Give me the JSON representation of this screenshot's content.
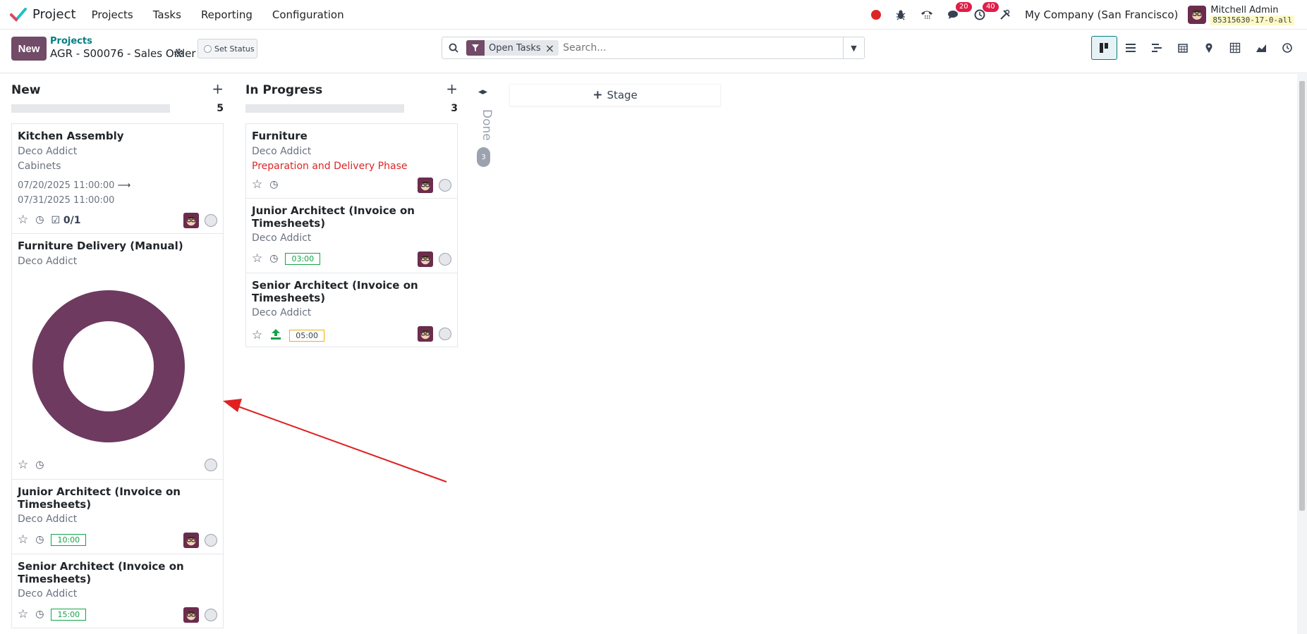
{
  "navbar": {
    "app_name": "Project",
    "menu": [
      "Projects",
      "Tasks",
      "Reporting",
      "Configuration"
    ],
    "messages_badge": "20",
    "activities_badge": "40",
    "company": "My Company (San Francisco)",
    "user_name": "Mitchell Admin",
    "db_name": "85315630-17-0-all"
  },
  "control": {
    "new_label": "New",
    "breadcrumb_parent": "Projects",
    "breadcrumb_current": "AGR - S00076 - Sales Order",
    "set_status_label": "Set Status",
    "facet_label": "Open Tasks",
    "search_placeholder": "Search...",
    "active_view": "kanban"
  },
  "kanban": {
    "columns": [
      {
        "title": "New",
        "count": "5",
        "cards": [
          {
            "title": "Kitchen Assembly",
            "customer": "Deco Addict",
            "tag": "Cabinets",
            "date_start": "07/20/2025 11:00:00",
            "date_arrow": "⟶",
            "date_end": "07/31/2025 11:00:00",
            "checklist": "0/1"
          },
          {
            "title": "Furniture Delivery (Manual)",
            "customer": "Deco Addict"
          },
          {
            "title": "Junior Architect (Invoice on Timesheets)",
            "customer": "Deco Addict",
            "hours": "10:00"
          },
          {
            "title": "Senior Architect (Invoice on Timesheets)",
            "customer": "Deco Addict",
            "hours": "15:00"
          }
        ]
      },
      {
        "title": "In Progress",
        "count": "3",
        "cards": [
          {
            "title": "Furniture",
            "customer": "Deco Addict",
            "milestone": "Preparation and Delivery Phase"
          },
          {
            "title": "Junior Architect (Invoice on Timesheets)",
            "customer": "Deco Addict",
            "hours": "03:00"
          },
          {
            "title": "Senior Architect (Invoice on Timesheets)",
            "customer": "Deco Addict",
            "hours": "05:00"
          }
        ]
      }
    ],
    "folded_column": {
      "title": "Done",
      "count": "3"
    },
    "add_stage_label": "Stage"
  },
  "colors": {
    "primary": "#714b67",
    "accent": "#017e84",
    "donut": "#6e3a60",
    "annotation_arrow": "#e02020",
    "badge_red": "#e11d48"
  }
}
